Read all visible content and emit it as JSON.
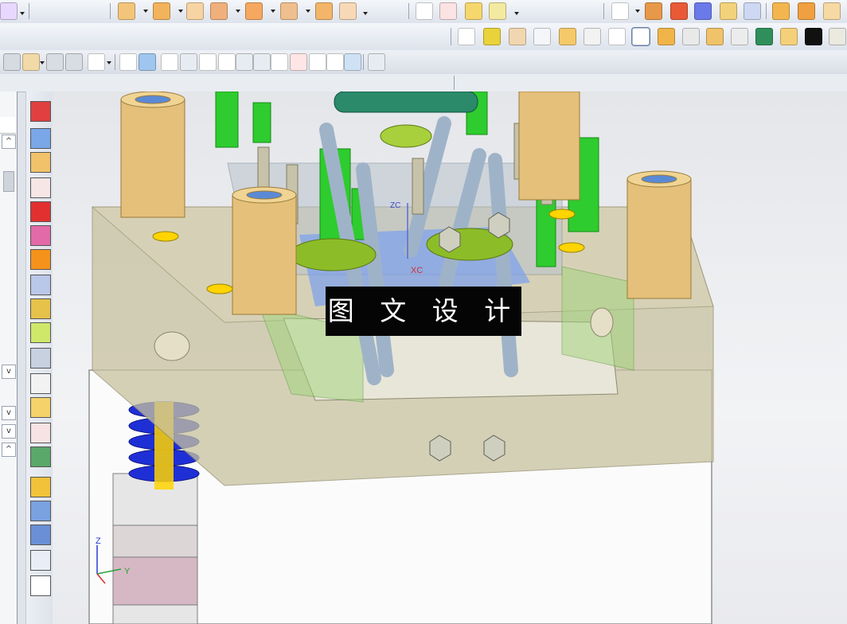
{
  "watermark": {
    "text": "图 文 设 计"
  },
  "triad": {
    "x_label": "Y",
    "z_label": "Z",
    "origin_label": "XC",
    "zc_label": "ZC"
  },
  "toolbar_row1": {
    "icons": [
      "font-color-icon",
      "feature-cube-icon",
      "extrude-icon",
      "subtract-icon",
      "copy-body-icon",
      "offset-body-icon",
      "measure-body-icon",
      "pattern-body-icon",
      "sheet-icon",
      "triangle-sketch-icon",
      "table-icon",
      "datum-plane-icon",
      "component-icon",
      "view-cube-icon",
      "render-book-icon",
      "shield-icon",
      "solid-block-icon",
      "slab-icon",
      "surface-icon",
      "stack-icon",
      "layers-icon",
      "network-icon"
    ]
  },
  "toolbar_row2": {
    "icons": [
      "edit-text-icon",
      "assembly-icon",
      "attributes-icon",
      "axis-icon",
      "block-icon",
      "disk-icon",
      "bracket-icon",
      "tools-icon",
      "stacked-plates-icon",
      "panel-icon",
      "pipe-fitting-icon",
      "section-icon",
      "ladder-icon",
      "graph-icon",
      "image-icon",
      "grid-icon"
    ]
  },
  "toolbar_row3": {
    "icons": [
      "snap-arrow-icon",
      "point-icon",
      "lasso-icon",
      "cursor-icon",
      "select-box-icon",
      "wireframe-icon",
      "shaded-icon",
      "vertex-snap-icon",
      "midpoint-icon",
      "line-icon",
      "slanted-line-icon",
      "curve-icon",
      "perpendicular-icon",
      "circle-snap-icon",
      "center-point-icon",
      "plus-icon",
      "tangent-icon",
      "camera-icon",
      "grid-snap-icon"
    ]
  },
  "sidebar": {
    "icons": [
      "cube-red-icon",
      "extrude-blue-icon",
      "revolve-icon",
      "boss-icon",
      "red-cylinder-icon",
      "surface-warp-icon",
      "orange-flag-icon",
      "stack-plates-icon",
      "stack-green-icon",
      "curve-spiral-icon",
      "mold-tool-icon",
      "check-box-icon",
      "cube-yellow-icon",
      "cube-frame-icon",
      "plate-split-icon",
      "funnel-icon",
      "bracket-pair-icon",
      "assembly-people-icon",
      "drawing-icon",
      "crosshair-icon"
    ]
  },
  "colors": {
    "accent": "#ffd400",
    "mold_plate": "#c8c2a0",
    "bushing": "#e4c07a",
    "green_pin": "#2ecc2e",
    "spring_blue": "#1f2fd6",
    "grey_pin": "#9fb3c8",
    "plate_pink": "#d6b8c4"
  }
}
